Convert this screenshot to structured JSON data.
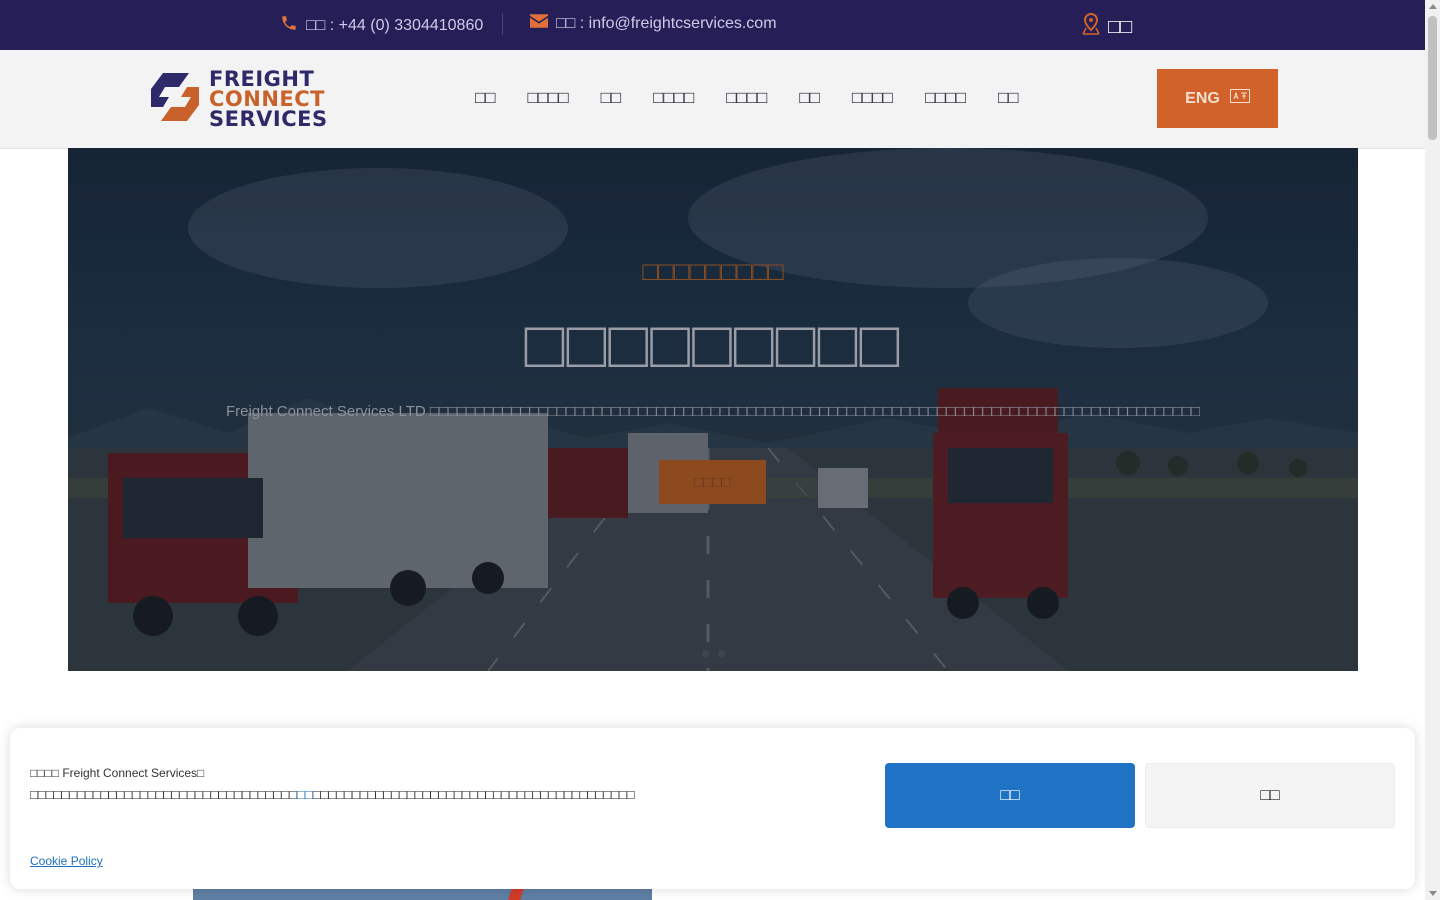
{
  "topbar": {
    "phone_text": "□□ : +44 (0) 3304410860",
    "email_text": "□□ : info@freightcservices.com",
    "location_label": "□□"
  },
  "logo": {
    "line1": "FREIGHT",
    "line2": "CONNECT",
    "line3": "SERVICES"
  },
  "nav": {
    "items": [
      "□□",
      "□□□□",
      "□□",
      "□□□□",
      "□□□□",
      "□□",
      "□□□□",
      "□□□□",
      "□□"
    ]
  },
  "lang_button": {
    "label": "ENG",
    "icon": "translate-icon"
  },
  "hero": {
    "subtitle": "□□□□□□□□□",
    "title": "□□□□□□□□□",
    "description": "Freight Connect Services LTD □□□□□□□□□□□□□□□□□□□□□□□□□□□□□□□□□□□□□□□□□□□□□□□□□□□□□□□□□□□□□□□□□□□□□□□□□□□□□□□□□□□□□",
    "button_label": "□□□□",
    "slide_dots": 2
  },
  "cookie": {
    "title": "□□□□ Freight Connect Services□",
    "text_before": "□□□□□□□□□□□□□□□□□□□□□□□□□□□□□□□□□□",
    "text_link": "□□",
    "text_after": "□□□□□□□□□□□□□□□□□□□□□□□□□□□□□□□□□□□□□□□□□",
    "policy_link": "Cookie Policy",
    "accept_label": "□□",
    "decline_label": "□□"
  },
  "colors": {
    "topbar_bg": "#261e57",
    "accent_orange": "#d0622a",
    "accept_blue": "#1f72c4",
    "header_bg": "#f3f3f4"
  }
}
